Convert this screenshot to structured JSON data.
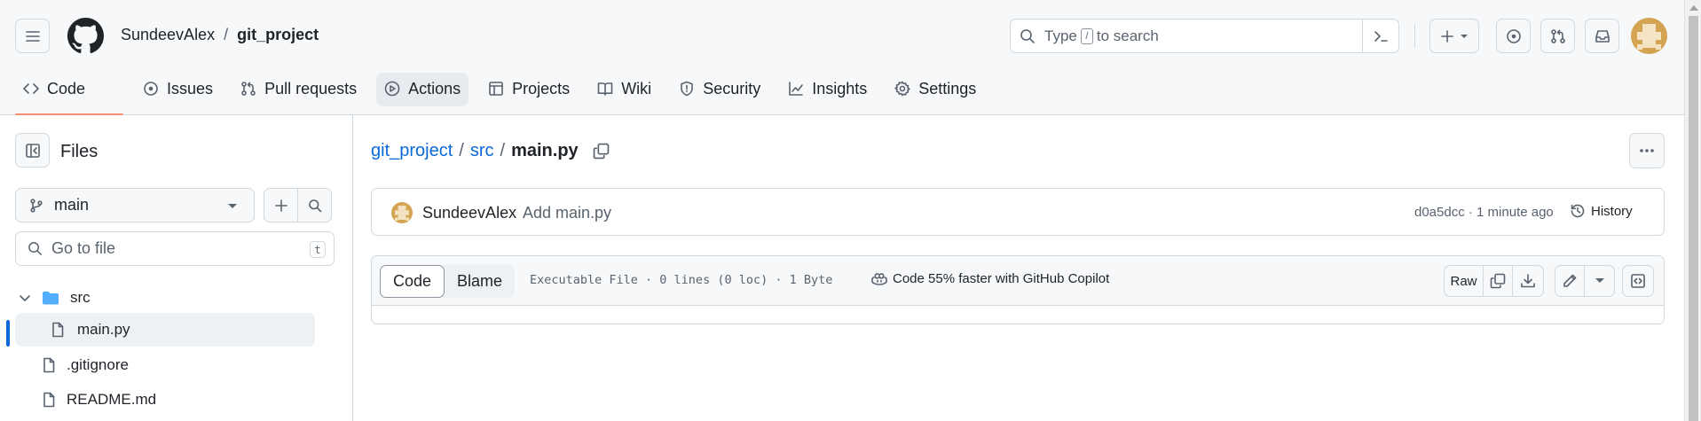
{
  "header": {
    "owner": "SundeevAlex",
    "separator": "/",
    "repo": "git_project",
    "search": {
      "prefix": "Type",
      "key": "/",
      "suffix": "to search"
    }
  },
  "tabs": [
    {
      "label": "Code",
      "icon": "code-icon",
      "selected": true
    },
    {
      "label": "Issues",
      "icon": "issue-opened-icon"
    },
    {
      "label": "Pull requests",
      "icon": "git-pull-request-icon"
    },
    {
      "label": "Actions",
      "icon": "play-icon"
    },
    {
      "label": "Projects",
      "icon": "table-icon"
    },
    {
      "label": "Wiki",
      "icon": "book-icon"
    },
    {
      "label": "Security",
      "icon": "shield-icon"
    },
    {
      "label": "Insights",
      "icon": "graph-icon"
    },
    {
      "label": "Settings",
      "icon": "gear-icon"
    }
  ],
  "sidebar": {
    "title": "Files",
    "branch": "main",
    "goto_placeholder": "Go to file",
    "goto_key": "t",
    "tree": [
      {
        "name": "src",
        "type": "folder",
        "expanded": true
      },
      {
        "name": "main.py",
        "type": "file",
        "selected": true
      },
      {
        "name": ".gitignore",
        "type": "file"
      },
      {
        "name": "README.md",
        "type": "file"
      }
    ]
  },
  "breadcrumb": {
    "repo": "git_project",
    "sep1": "/",
    "dir": "src",
    "sep2": "/",
    "file": "main.py"
  },
  "commit": {
    "author": "SundeevAlex",
    "message": "Add main.py",
    "meta": "d0a5dcc · 1 minute ago",
    "history_label": "History"
  },
  "file_view": {
    "tab_code": "Code",
    "tab_blame": "Blame",
    "info": "Executable File · 0 lines (0 loc) · 1 Byte",
    "copilot": "Code 55% faster with GitHub Copilot",
    "raw_label": "Raw"
  },
  "colors": {
    "accent_link": "#0969da",
    "tab_underline": "#fd8c73",
    "folder": "#54aeff",
    "avatar": "#d4a452"
  }
}
